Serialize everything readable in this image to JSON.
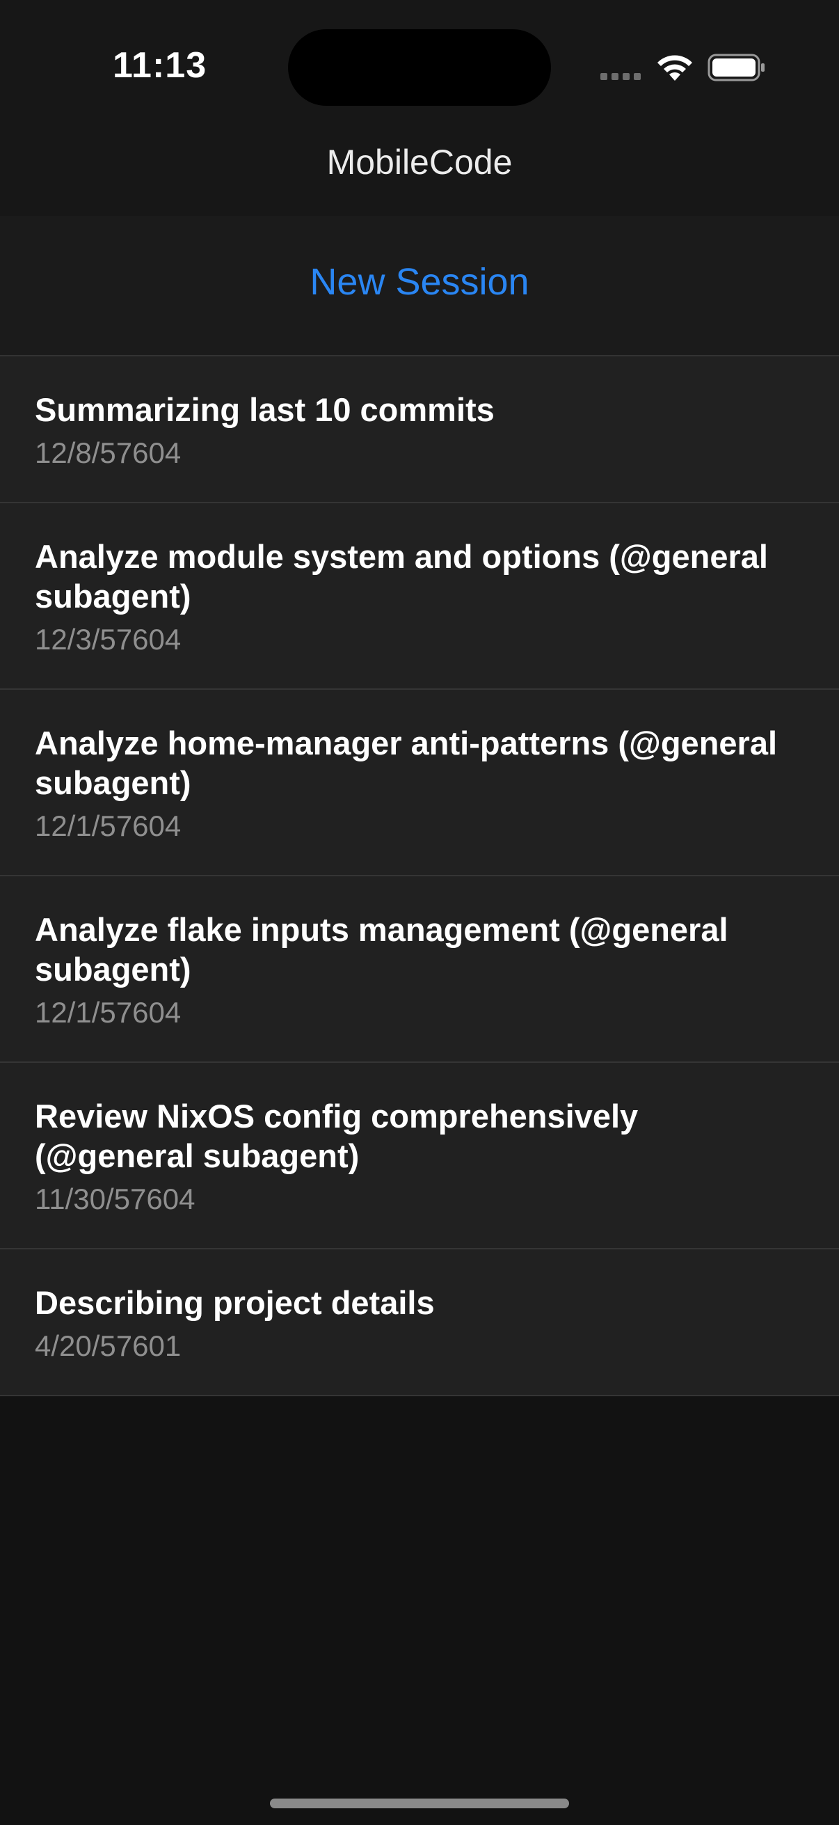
{
  "status_bar": {
    "time": "11:13",
    "icons": [
      "signal-icon",
      "wifi-icon",
      "battery-icon"
    ]
  },
  "nav": {
    "title": "MobileCode"
  },
  "toolbar": {
    "new_session_label": "New Session",
    "accent_color": "#2a86f3"
  },
  "sessions": [
    {
      "title": "Summarizing last 10 commits",
      "date": "12/8/57604"
    },
    {
      "title": "Analyze module system and options (@general subagent)",
      "date": "12/3/57604"
    },
    {
      "title": "Analyze home-manager anti-patterns (@general subagent)",
      "date": "12/1/57604"
    },
    {
      "title": "Analyze flake inputs management (@general subagent)",
      "date": "12/1/57604"
    },
    {
      "title": "Review NixOS config comprehensively (@general subagent)",
      "date": "11/30/57604"
    },
    {
      "title": "Describing project details",
      "date": "4/20/57601"
    }
  ]
}
